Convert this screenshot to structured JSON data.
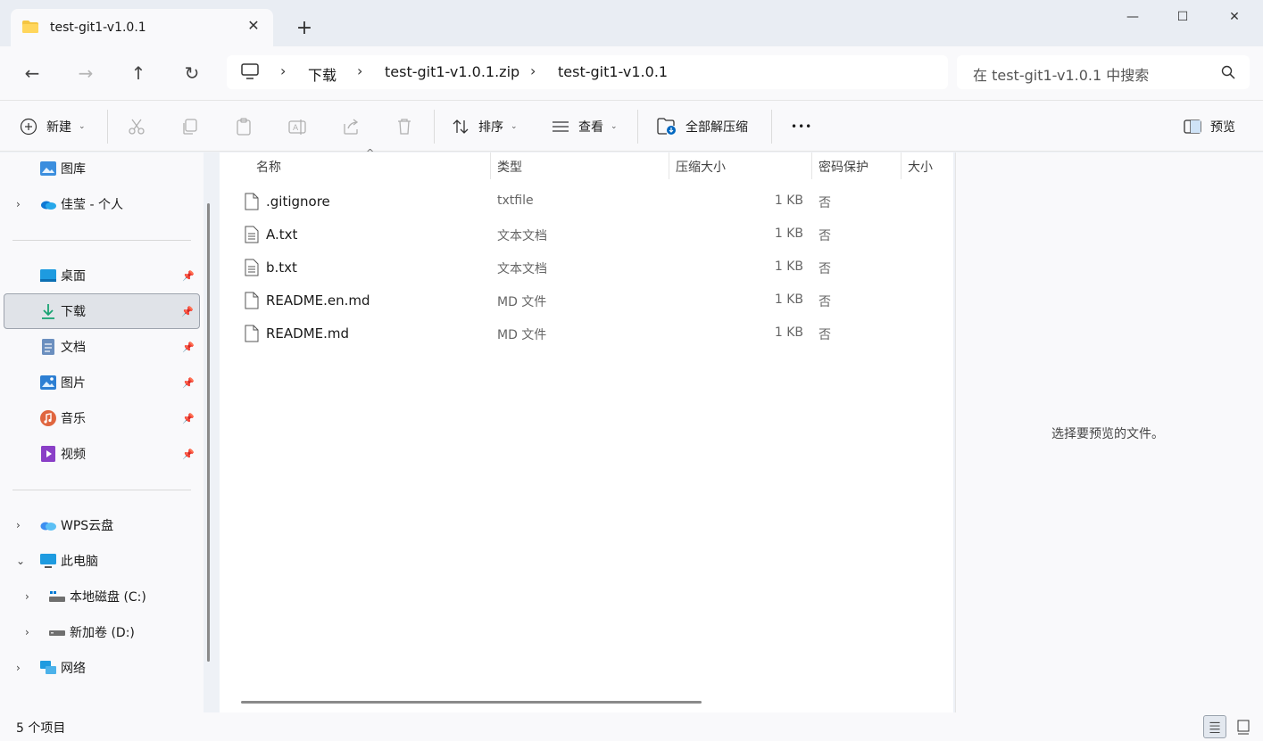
{
  "window": {
    "tab_title": "test-git1-v1.0.1",
    "new_tab": "+",
    "minimize": "—",
    "maximize": "☐",
    "close": "✕"
  },
  "nav": {
    "back": "←",
    "forward": "→",
    "up": "↑",
    "refresh": "↻",
    "breadcrumbs": [
      "下载",
      "test-git1-v1.0.1.zip",
      "test-git1-v1.0.1"
    ],
    "search_placeholder": "在 test-git1-v1.0.1 中搜索"
  },
  "toolbar": {
    "new_label": "新建",
    "sort_label": "排序",
    "view_label": "查看",
    "extract_label": "全部解压缩",
    "more": "•••",
    "preview_label": "预览"
  },
  "sidebar": {
    "items": [
      {
        "label": "图库",
        "icon": "gallery-icon"
      },
      {
        "label": "佳莹 - 个人",
        "icon": "onedrive-icon"
      },
      {
        "label": "桌面",
        "icon": "desktop-icon"
      },
      {
        "label": "下载",
        "icon": "download-icon"
      },
      {
        "label": "文档",
        "icon": "documents-icon"
      },
      {
        "label": "图片",
        "icon": "pictures-icon"
      },
      {
        "label": "音乐",
        "icon": "music-icon"
      },
      {
        "label": "视频",
        "icon": "videos-icon"
      },
      {
        "label": "WPS云盘",
        "icon": "wps-cloud-icon"
      },
      {
        "label": "此电脑",
        "icon": "this-pc-icon"
      },
      {
        "label": "本地磁盘 (C:)",
        "icon": "drive-c-icon"
      },
      {
        "label": "新加卷 (D:)",
        "icon": "drive-d-icon"
      },
      {
        "label": "网络",
        "icon": "network-icon"
      }
    ]
  },
  "columns": {
    "name": "名称",
    "type": "类型",
    "compressed": "压缩大小",
    "protected": "密码保护",
    "size": "大小"
  },
  "files": [
    {
      "name": ".gitignore",
      "type": "txtfile",
      "size": "1 KB",
      "protected": "否"
    },
    {
      "name": "A.txt",
      "type": "文本文档",
      "size": "1 KB",
      "protected": "否"
    },
    {
      "name": "b.txt",
      "type": "文本文档",
      "size": "1 KB",
      "protected": "否"
    },
    {
      "name": "README.en.md",
      "type": "MD 文件",
      "size": "1 KB",
      "protected": "否"
    },
    {
      "name": "README.md",
      "type": "MD 文件",
      "size": "1 KB",
      "protected": "否"
    }
  ],
  "preview": {
    "message": "选择要预览的文件。"
  },
  "status": {
    "count": "5 个项目"
  },
  "colors": {
    "accent": "#0067c0",
    "folder": "#f4c542"
  }
}
